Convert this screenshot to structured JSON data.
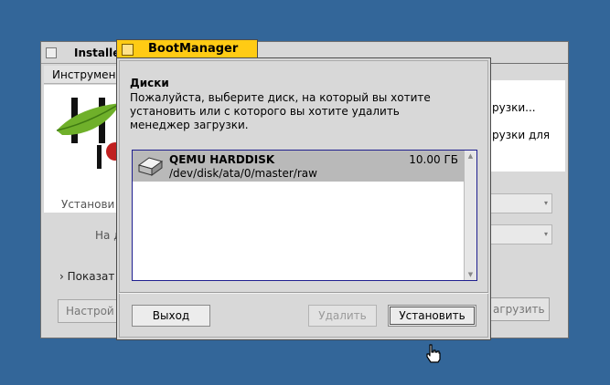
{
  "installer": {
    "title": "Installe",
    "menu_label": "Инструмен",
    "install_label": "Установи",
    "on_label": "На д",
    "show_options_label": "Показат",
    "setup_button": "Настрой",
    "right_text_line1": "рузки...",
    "right_text_line2": "рузки для",
    "load_button": "агрузить"
  },
  "boot_manager": {
    "title": "BootManager",
    "heading": "Диски",
    "description": "Пожалуйста, выберите диск, на который вы хотите установить или с которого вы хотите удалить менеджер загрузки.",
    "disks": [
      {
        "name": "QEMU HARDDISK",
        "path": "/dev/disk/ata/0/master/raw",
        "size": "10.00 ГБ",
        "selected": true
      }
    ],
    "buttons": {
      "exit": "Выход",
      "remove": "Удалить",
      "install": "Установить"
    }
  },
  "colors": {
    "desktop": "#336699",
    "tab_active": "#ffcb14",
    "selection": "#b9b9b9"
  },
  "icons": [
    "close-box-icon",
    "hard-disk-icon",
    "scroll-up-icon",
    "scroll-down-icon",
    "hand-pointer-icon",
    "dropdown-arrow-icon",
    "haiku-leaf-logo"
  ]
}
